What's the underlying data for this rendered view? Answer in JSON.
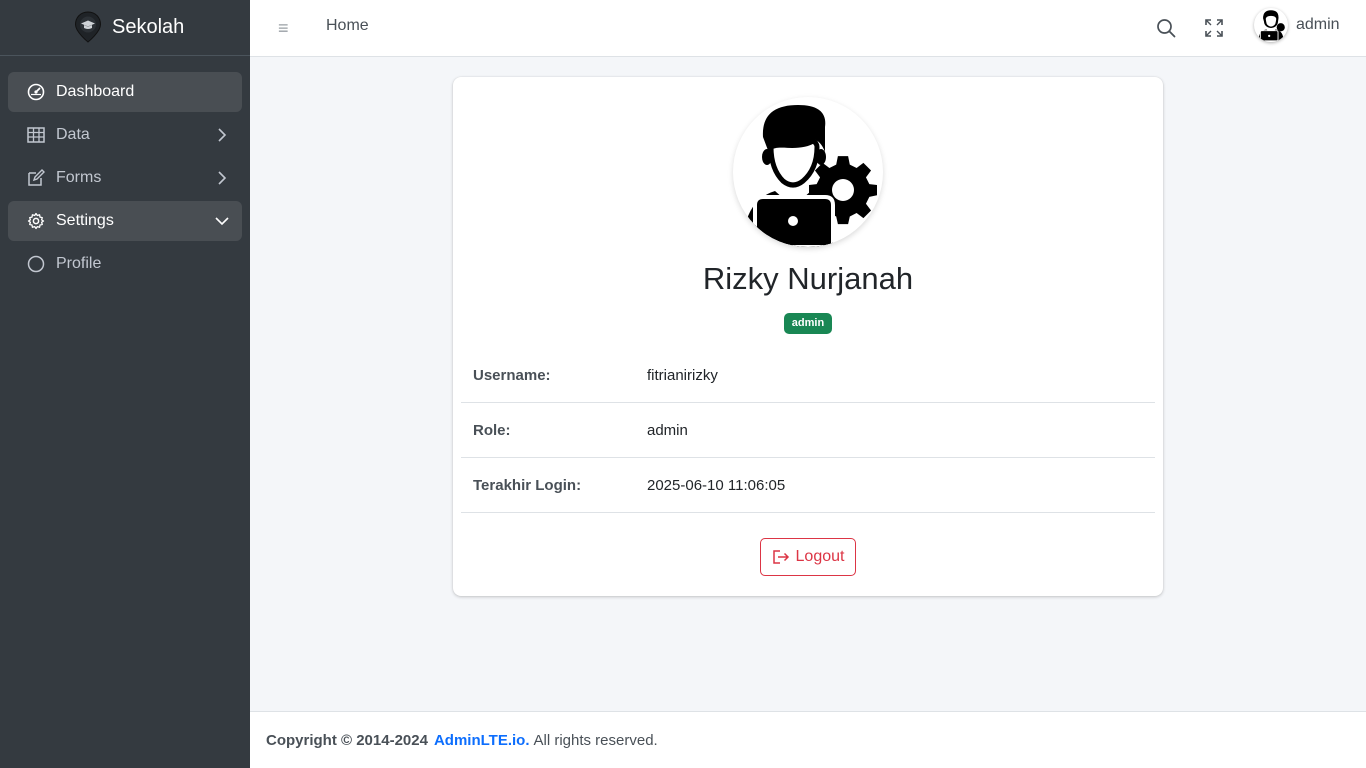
{
  "brand": {
    "name": "Sekolah",
    "logo_icon": "map-pin-graduation-icon"
  },
  "sidebar": {
    "items": [
      {
        "label": "Dashboard",
        "icon": "speedometer-icon",
        "state": "active"
      },
      {
        "label": "Data",
        "icon": "table-icon",
        "arrow": "chevron-right-icon"
      },
      {
        "label": "Forms",
        "icon": "pencil-square-icon",
        "arrow": "chevron-right-icon"
      },
      {
        "label": "Settings",
        "icon": "gear-icon",
        "arrow": "chevron-down-icon",
        "state": "open"
      },
      {
        "label": "Profile",
        "icon": "circle-icon"
      }
    ]
  },
  "header": {
    "menu_icon": "≡",
    "home_label": "Home",
    "username": "admin"
  },
  "profile": {
    "name": "Rizky Nurjanah",
    "role_badge": "admin",
    "rows": [
      {
        "label": "Username:",
        "value": "fitrianirizky"
      },
      {
        "label": "Role:",
        "value": "admin"
      },
      {
        "label": "Terakhir Login:",
        "value": "2025-06-10 11:06:05"
      }
    ],
    "logout_label": "Logout"
  },
  "footer": {
    "copyright": "Copyright © 2014-2024",
    "link_text": "AdminLTE.io.",
    "suffix": "All rights reserved."
  },
  "colors": {
    "sidebar_bg": "#343a40",
    "badge_bg": "#198754",
    "danger": "#dc3545",
    "link": "#0d6efd"
  }
}
